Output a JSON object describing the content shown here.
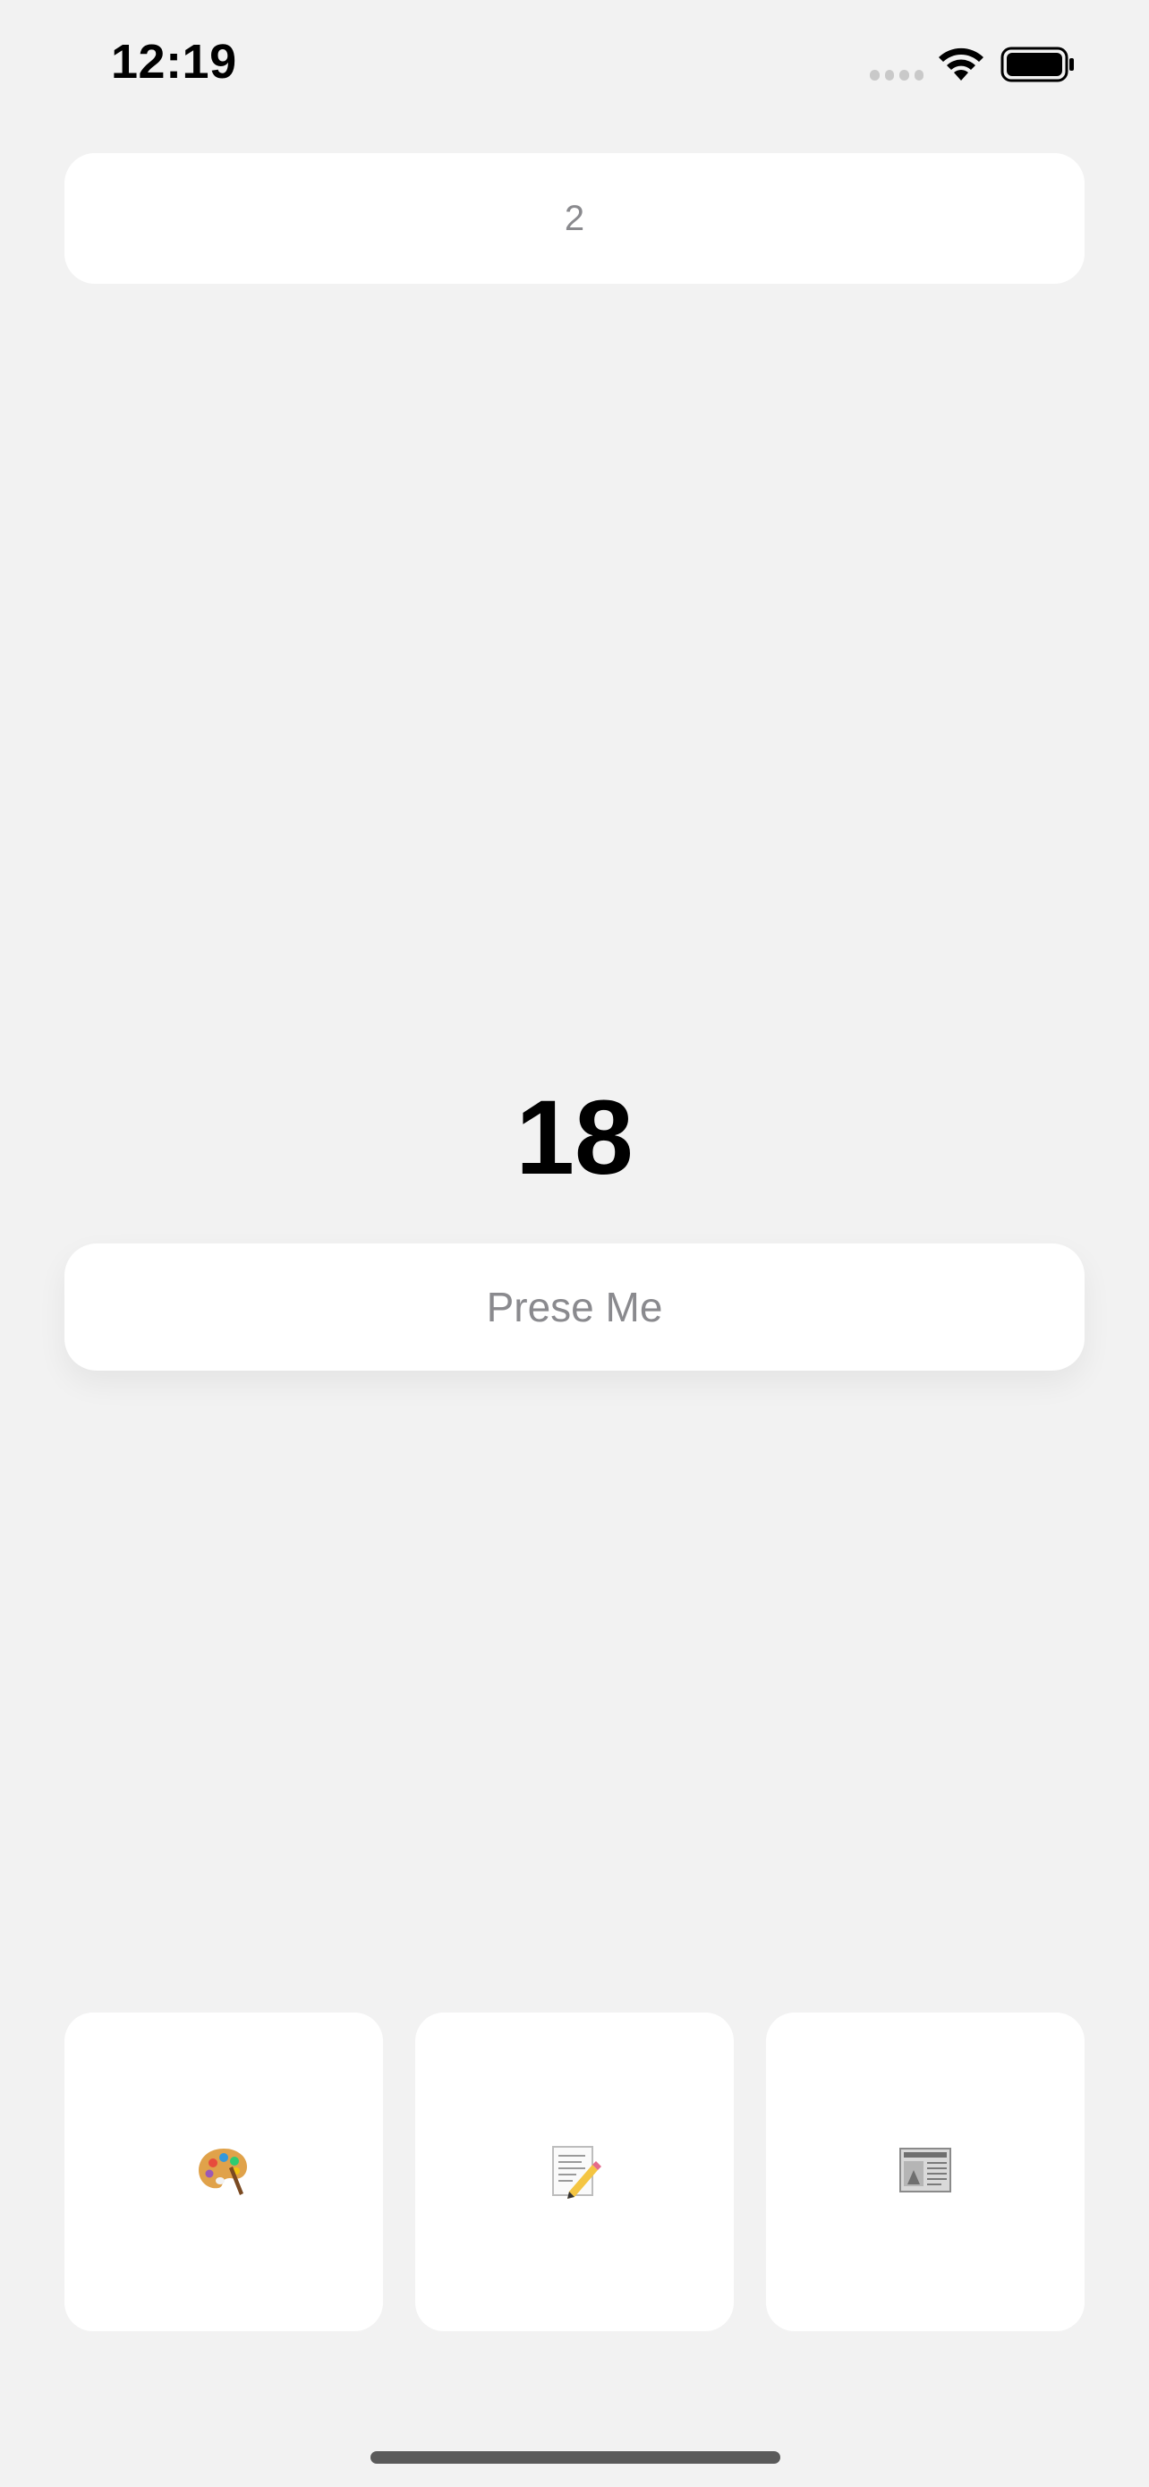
{
  "status_bar": {
    "time": "12:19",
    "wifi_icon": "wifi-icon",
    "battery_icon": "battery-icon"
  },
  "top_field": {
    "value": "2"
  },
  "counter": {
    "value": "18"
  },
  "press_button": {
    "label": "Prese Me"
  },
  "tiles": [
    {
      "icon": "palette-icon"
    },
    {
      "icon": "memo-icon"
    },
    {
      "icon": "newspaper-icon"
    }
  ],
  "colors": {
    "background": "#f2f2f2",
    "card": "#ffffff",
    "placeholder_text": "#8a8a8e",
    "counter_text": "#000000"
  }
}
